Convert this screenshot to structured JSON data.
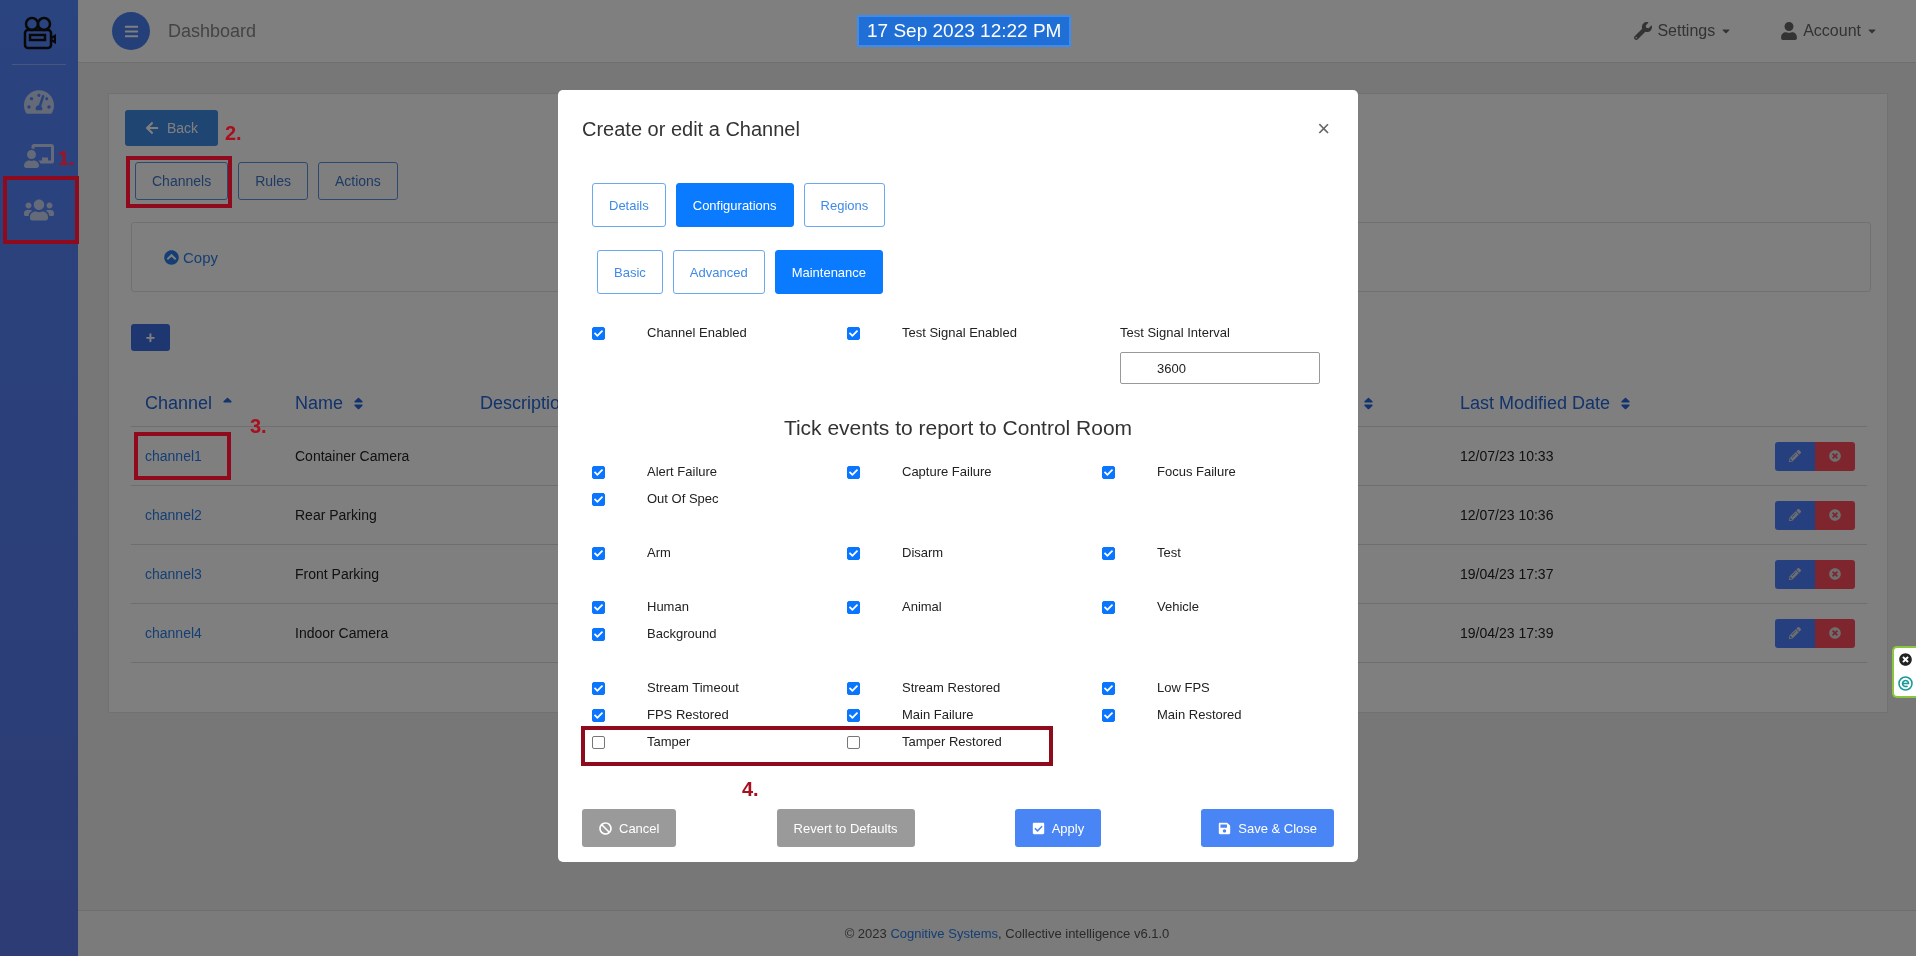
{
  "sidebar": {
    "items": [
      {
        "kind": "gauge"
      },
      {
        "kind": "presenter"
      },
      {
        "kind": "users",
        "callout": "1."
      }
    ]
  },
  "header": {
    "title": "Dashboard",
    "datetime": "17 Sep 2023 12:22 PM",
    "menus": [
      {
        "label": "Settings",
        "kind": "settings"
      },
      {
        "label": "Account",
        "kind": "account"
      }
    ]
  },
  "page": {
    "back": "Back",
    "tabs": [
      {
        "label": "Channels",
        "callout": "2."
      },
      {
        "label": "Rules"
      },
      {
        "label": "Actions"
      }
    ],
    "copy": "Copy",
    "add": "+"
  },
  "table": {
    "columns": [
      {
        "label": "Channel",
        "sortable": true,
        "sorted": true
      },
      {
        "label": "Name",
        "sortable": true,
        "sorted": false
      },
      {
        "label": "Descriptio",
        "sortable": false,
        "sorted": false
      },
      {
        "sortable": true,
        "sorted": false
      },
      {
        "label": "Last Modified Date",
        "sortable": true,
        "sorted": false
      }
    ],
    "rows": [
      {
        "channel": "channel1",
        "name": "Container Camera",
        "modified": "12/07/23 10:33",
        "callout": "3."
      },
      {
        "channel": "channel2",
        "name": "Rear Parking",
        "modified": "12/07/23 10:36"
      },
      {
        "channel": "channel3",
        "name": "Front Parking",
        "modified": "19/04/23 17:37"
      },
      {
        "channel": "channel4",
        "name": "Indoor Camera",
        "modified": "19/04/23 17:39"
      }
    ]
  },
  "modal": {
    "title": "Create or edit a Channel",
    "close": "×",
    "tabs": [
      {
        "label": "Details",
        "selected": false
      },
      {
        "label": "Configurations",
        "selected": true
      },
      {
        "label": "Regions",
        "selected": false
      }
    ],
    "subtabs": [
      {
        "label": "Basic",
        "selected": false
      },
      {
        "label": "Advanced",
        "selected": false
      },
      {
        "label": "Maintenance",
        "selected": true
      }
    ],
    "settings": [
      {
        "label": "Channel Enabled",
        "checked": true
      },
      {
        "label": "Test Signal Enabled",
        "checked": true
      }
    ],
    "interval": {
      "label": "Test Signal Interval",
      "value": "3600"
    },
    "heading": "Tick events to report to Control Room",
    "event_groups": [
      {
        "rows": [
          {
            "items": [
              {
                "label": "Alert Failure",
                "checked": true
              },
              {
                "label": "Capture Failure",
                "checked": true
              },
              {
                "label": "Focus Failure",
                "checked": true
              }
            ]
          },
          {
            "items": [
              {
                "label": "Out Of Spec",
                "checked": true
              }
            ]
          }
        ]
      },
      {
        "rows": [
          {
            "items": [
              {
                "label": "Arm",
                "checked": true
              },
              {
                "label": "Disarm",
                "checked": true
              },
              {
                "label": "Test",
                "checked": true
              }
            ]
          }
        ]
      },
      {
        "rows": [
          {
            "items": [
              {
                "label": "Human",
                "checked": true
              },
              {
                "label": "Animal",
                "checked": true
              },
              {
                "label": "Vehicle",
                "checked": true
              }
            ]
          },
          {
            "items": [
              {
                "label": "Background",
                "checked": true
              }
            ]
          }
        ]
      },
      {
        "rows": [
          {
            "items": [
              {
                "label": "Stream Timeout",
                "checked": true
              },
              {
                "label": "Stream Restored",
                "checked": true
              },
              {
                "label": "Low FPS",
                "checked": true
              }
            ]
          },
          {
            "items": [
              {
                "label": "FPS Restored",
                "checked": true
              },
              {
                "label": "Main Failure",
                "checked": true
              },
              {
                "label": "Main Restored",
                "checked": true
              }
            ]
          },
          {
            "items": [
              {
                "label": "Tamper",
                "checked": false
              },
              {
                "label": "Tamper Restored",
                "checked": false
              }
            ],
            "callout": "4."
          }
        ]
      }
    ],
    "buttons": [
      {
        "label": "Cancel",
        "kind": "cancel"
      },
      {
        "label": "Revert to Defaults",
        "kind": "revert"
      },
      {
        "label": "Apply",
        "kind": "apply"
      },
      {
        "label": "Save & Close",
        "kind": "save"
      }
    ]
  },
  "footer": {
    "before": "© 2023 ",
    "link": "Cognitive Systems",
    "after": ", Collective intelligence v6.1.0"
  }
}
